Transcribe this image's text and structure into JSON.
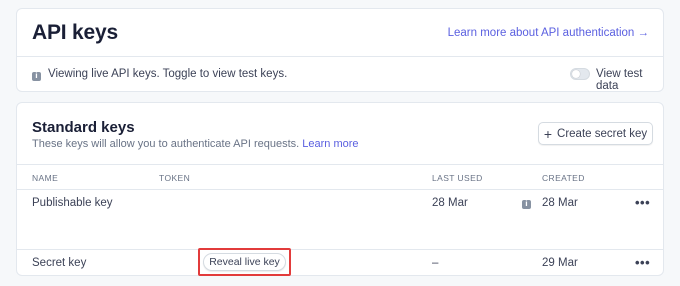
{
  "header": {
    "title": "API keys",
    "learn_link": "Learn more about API authentication",
    "learn_arrow": "→"
  },
  "notice": {
    "text": "Viewing live API keys. Toggle to view test keys.",
    "toggle_label": "View test data",
    "toggle_on": false
  },
  "standard_keys": {
    "title": "Standard keys",
    "subtitle": "These keys will allow you to authenticate API requests.",
    "learn_more": "Learn more",
    "create_button": "Create secret key",
    "columns": [
      "NAME",
      "TOKEN",
      "LAST USED",
      "CREATED"
    ],
    "rows": [
      {
        "name": "Publishable key",
        "token": "",
        "last_used": "28 Mar",
        "created": "28 Mar",
        "actions": "•••"
      },
      {
        "name": "Secret key",
        "token": "",
        "reveal_label": "Reveal live key",
        "last_used": "–",
        "created": "29 Mar",
        "actions": "•••"
      }
    ]
  },
  "colors": {
    "accent": "#5a5fe0",
    "highlight": "#e23b3b",
    "background": "#f6f8fa"
  },
  "icons": [
    "info-icon",
    "arrow-right-icon",
    "plus-icon",
    "more-icon"
  ]
}
